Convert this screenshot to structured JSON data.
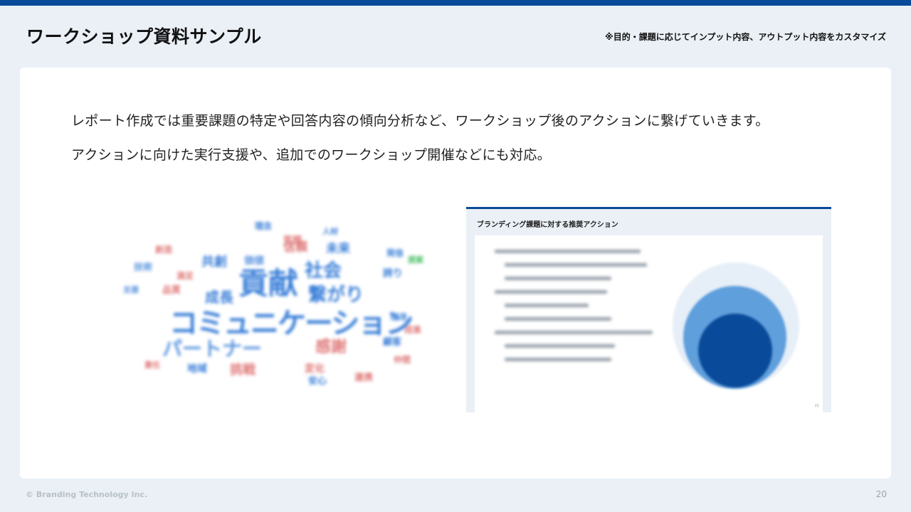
{
  "header": {
    "title": "ワークショップ資料サンプル",
    "note": "※目的・課題に応じてインプット内容、アウトプット内容をカスタマイズ"
  },
  "body": {
    "line1": "レポート作成では重要課題の特定や回答内容の傾向分析など、ワークショップ後のアクションに繋げていきます。",
    "line2": "アクションに向けた実行支援や、追加でのワークショップ開催などにも対応。"
  },
  "wordcloud": {
    "words": [
      "貢献",
      "社会",
      "繋がり",
      "コミュニケーション",
      "パートナー",
      "感謝",
      "成長",
      "信頼",
      "未来",
      "共創",
      "価値",
      "挑戦",
      "誇り",
      "笑顔",
      "地域",
      "技術",
      "品質",
      "顧客",
      "安心",
      "仲間",
      "変化",
      "理念",
      "満足",
      "発信",
      "連携",
      "創造",
      "人材",
      "環境",
      "成果",
      "責任",
      "提案",
      "支援"
    ]
  },
  "thumbnail": {
    "title": "ブランディング課題に対する推奨アクション",
    "page": "21"
  },
  "footer": {
    "copyright": "© Branding Technology Inc.",
    "page_number": "20"
  },
  "colors": {
    "accent": "#0a4a9a",
    "background": "#eaf0f6",
    "cloud_blue": "#3a7fd8",
    "cloud_red": "#e07a7a",
    "cloud_green": "#4ec06a"
  }
}
